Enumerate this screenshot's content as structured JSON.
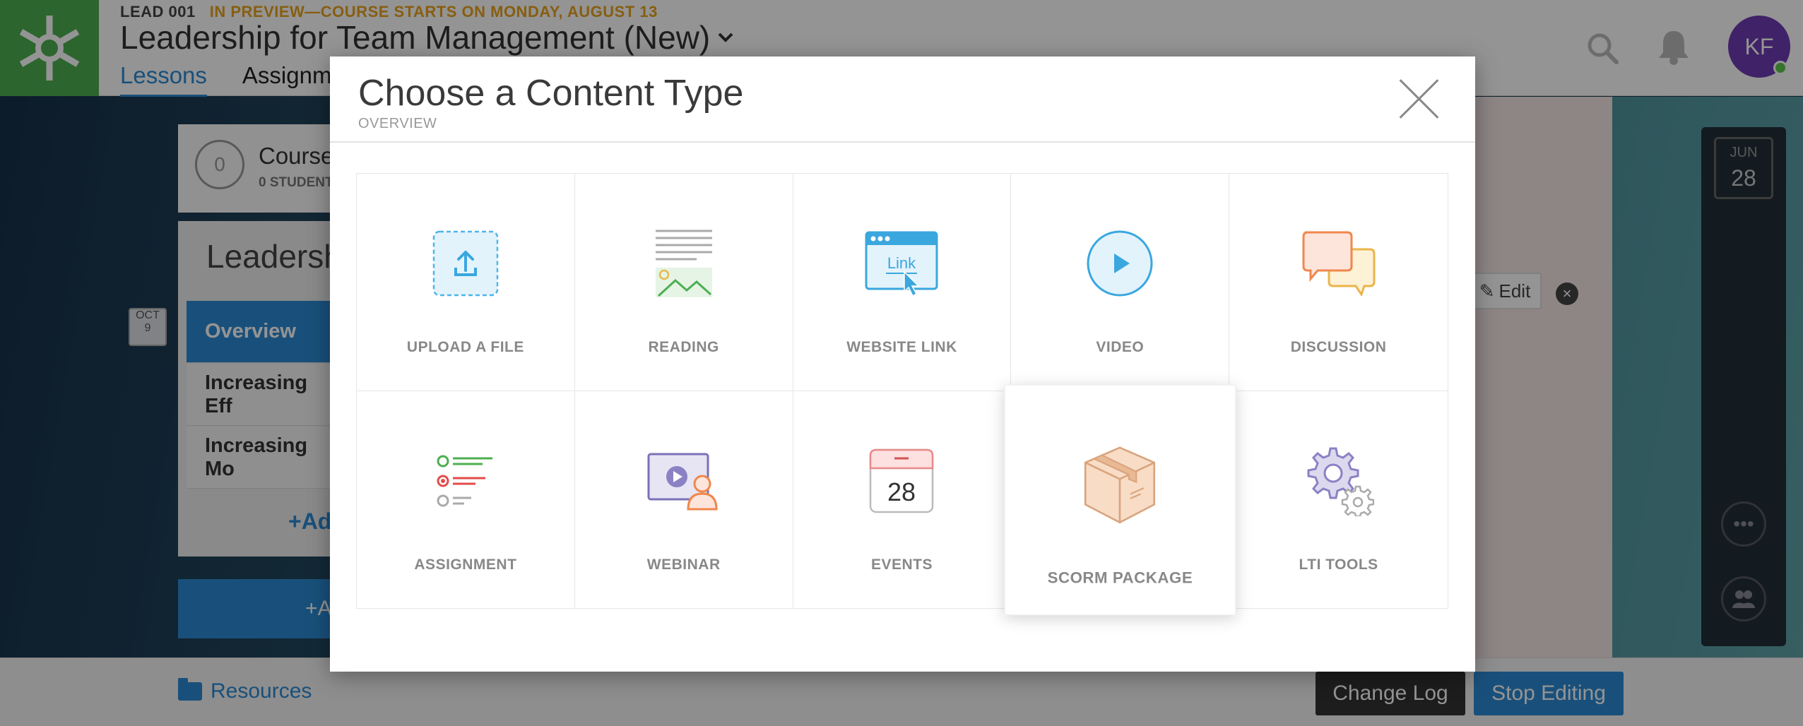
{
  "course": {
    "code": "LEAD 001",
    "preview_note": "IN PREVIEW—COURSE STARTS ON MONDAY, AUGUST 13",
    "title": "Leadership for Team Management (New)"
  },
  "nav": {
    "tabs": [
      {
        "label": "Lessons",
        "active": true
      },
      {
        "label": "Assignm",
        "active": false
      }
    ]
  },
  "user": {
    "initials": "KF",
    "status_color": "#5cc94a"
  },
  "left_panel": {
    "count": "0",
    "title": "Course",
    "subtitle": "0 STUDENT"
  },
  "lessons_panel": {
    "title": "Leadership",
    "items": [
      {
        "label": "Overview",
        "active": true
      },
      {
        "label": "Increasing Eff",
        "active": false
      },
      {
        "label": "Increasing Mo",
        "active": false
      }
    ],
    "add_label": "+Ad",
    "add_bar_label": "+A"
  },
  "date_badges": {
    "left": {
      "month": "OCT",
      "day": "9"
    },
    "right": {
      "month": "JUN",
      "day": "28"
    }
  },
  "card_actions": {
    "edit_label": "Edit",
    "remove_icon": "close-circle-icon"
  },
  "bottom_bar": {
    "resources_label": "Resources",
    "change_log_label": "Change Log",
    "stop_editing_label": "Stop Editing"
  },
  "modal": {
    "title": "Choose a Content Type",
    "subtitle": "OVERVIEW",
    "tiles": [
      {
        "label": "UPLOAD A FILE",
        "icon": "upload-icon"
      },
      {
        "label": "READING",
        "icon": "reading-icon"
      },
      {
        "label": "WEBSITE LINK",
        "icon": "website-link-icon",
        "icon_text": "Link"
      },
      {
        "label": "VIDEO",
        "icon": "video-play-icon"
      },
      {
        "label": "DISCUSSION",
        "icon": "discussion-icon"
      },
      {
        "label": "ASSIGNMENT",
        "icon": "assignment-icon"
      },
      {
        "label": "WEBINAR",
        "icon": "webinar-icon"
      },
      {
        "label": "EVENTS",
        "icon": "calendar-icon",
        "icon_text": "28"
      },
      {
        "label": "SCORM PACKAGE",
        "icon": "package-box-icon",
        "hovered": true
      },
      {
        "label": "LTI TOOLS",
        "icon": "gears-icon"
      }
    ]
  },
  "colors": {
    "brand_green": "#4caf50",
    "accent_blue": "#2b8ad5",
    "preview_orange": "#e9a21d",
    "avatar_purple": "#6f3bb3"
  }
}
